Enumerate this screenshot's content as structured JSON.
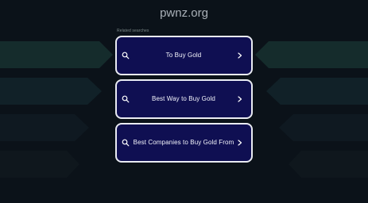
{
  "site": {
    "domain": "pwnz.org"
  },
  "related": {
    "label": "Related searches",
    "items": [
      {
        "label": "To Buy Gold",
        "icon": "search-icon",
        "arrow": "chevron-right-icon"
      },
      {
        "label": "Best Way to Buy Gold",
        "icon": "search-icon",
        "arrow": "chevron-right-icon"
      },
      {
        "label": "Best Companies to Buy Gold From",
        "icon": "search-icon",
        "arrow": "chevron-right-icon"
      }
    ]
  },
  "colors": {
    "background": "#0b1219",
    "card_background": "#0f0f52",
    "card_border": "#e9ebf2",
    "text_primary": "#f3f4fb",
    "title_text": "#a9b0b8"
  }
}
